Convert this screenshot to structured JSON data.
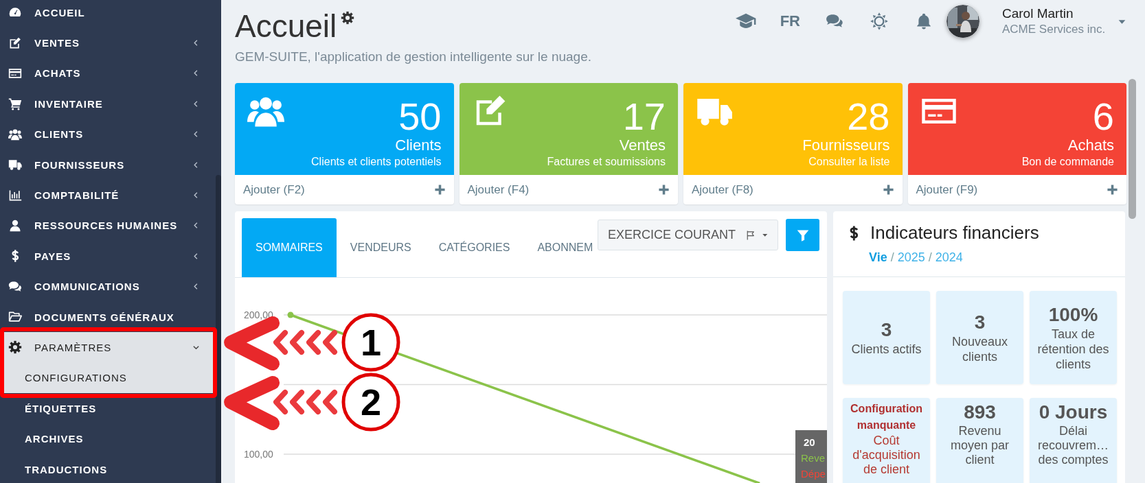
{
  "sidebar": {
    "items": [
      {
        "label": "ACCUEIL",
        "kind": "link"
      },
      {
        "label": "VENTES",
        "kind": "group",
        "expanded": false
      },
      {
        "label": "ACHATS",
        "kind": "group",
        "expanded": false
      },
      {
        "label": "INVENTAIRE",
        "kind": "group",
        "expanded": false
      },
      {
        "label": "CLIENTS",
        "kind": "group",
        "expanded": false
      },
      {
        "label": "FOURNISSEURS",
        "kind": "group",
        "expanded": false
      },
      {
        "label": "COMPTABILITÉ",
        "kind": "group",
        "expanded": false
      },
      {
        "label": "RESSOURCES HUMAINES",
        "kind": "group",
        "expanded": false
      },
      {
        "label": "PAYES",
        "kind": "group",
        "expanded": false
      },
      {
        "label": "COMMUNICATIONS",
        "kind": "group",
        "expanded": false
      },
      {
        "label": "DOCUMENTS GÉNÉRAUX",
        "kind": "link"
      },
      {
        "label": "PARAMÈTRES",
        "kind": "group",
        "expanded": true,
        "children": [
          {
            "label": "CONFIGURATIONS",
            "selected": true
          },
          {
            "label": "ÉTIQUETTES",
            "selected": false
          },
          {
            "label": "ARCHIVES",
            "selected": false
          },
          {
            "label": "TRADUCTIONS",
            "selected": false
          }
        ]
      }
    ]
  },
  "header": {
    "title": "Accueil",
    "subtitle": "GEM-SUITE, l'application de gestion intelligente sur le nuage.",
    "language": "FR",
    "user": {
      "name": "Carol Martin",
      "company": "ACME Services inc."
    }
  },
  "cards": [
    {
      "value": "50",
      "title": "Clients",
      "subtitle": "Clients et clients potentiels",
      "action": "Ajouter (F2)",
      "color": "#03a9f4"
    },
    {
      "value": "17",
      "title": "Ventes",
      "subtitle": "Factures et soumissions",
      "action": "Ajouter (F4)",
      "color": "#8bc34a"
    },
    {
      "value": "28",
      "title": "Fournisseurs",
      "subtitle": "Consulter la liste",
      "action": "Ajouter (F8)",
      "color": "#ffc107"
    },
    {
      "value": "6",
      "title": "Achats",
      "subtitle": "Bon de commande",
      "action": "Ajouter (F9)",
      "color": "#f44336"
    }
  ],
  "chart_panel": {
    "tabs": [
      {
        "label": "SOMMAIRES",
        "selected": true
      },
      {
        "label": "VENDEURS",
        "selected": false
      },
      {
        "label": "CATÉGORIES",
        "selected": false
      },
      {
        "label": "ABONNEM",
        "selected": false
      }
    ],
    "period_select": "EXERCICE COURANT",
    "axis_labels": [
      "200,00",
      "100,00"
    ],
    "tooltip": {
      "title": "20",
      "lines": [
        {
          "text": "Reve",
          "color": "#8bc34a"
        },
        {
          "text": "Dépe",
          "color": "#f44336"
        }
      ]
    }
  },
  "financial_panel": {
    "title": "Indicateurs financiers",
    "separator": "/",
    "periods": [
      {
        "label": "Vie",
        "selected": true
      },
      {
        "label": "2025",
        "selected": false
      },
      {
        "label": "2024",
        "selected": false
      }
    ],
    "tiles": [
      {
        "kind": "metric",
        "value": "3",
        "label": "Clients actifs"
      },
      {
        "kind": "metric",
        "value": "3",
        "label": "Nouveaux clients"
      },
      {
        "kind": "metric",
        "value": "100%",
        "label": "Taux de rétention des clients"
      },
      {
        "kind": "warning",
        "value": "Configuration manquante",
        "label": "Coût d'acquisition de client"
      },
      {
        "kind": "metric",
        "value": "893",
        "label": "Revenu moyen par client"
      },
      {
        "kind": "metric",
        "value": "0 Jours",
        "label": "Délai recouvrem… des comptes"
      }
    ]
  },
  "annotations": [
    {
      "label": "1"
    },
    {
      "label": "2"
    }
  ]
}
